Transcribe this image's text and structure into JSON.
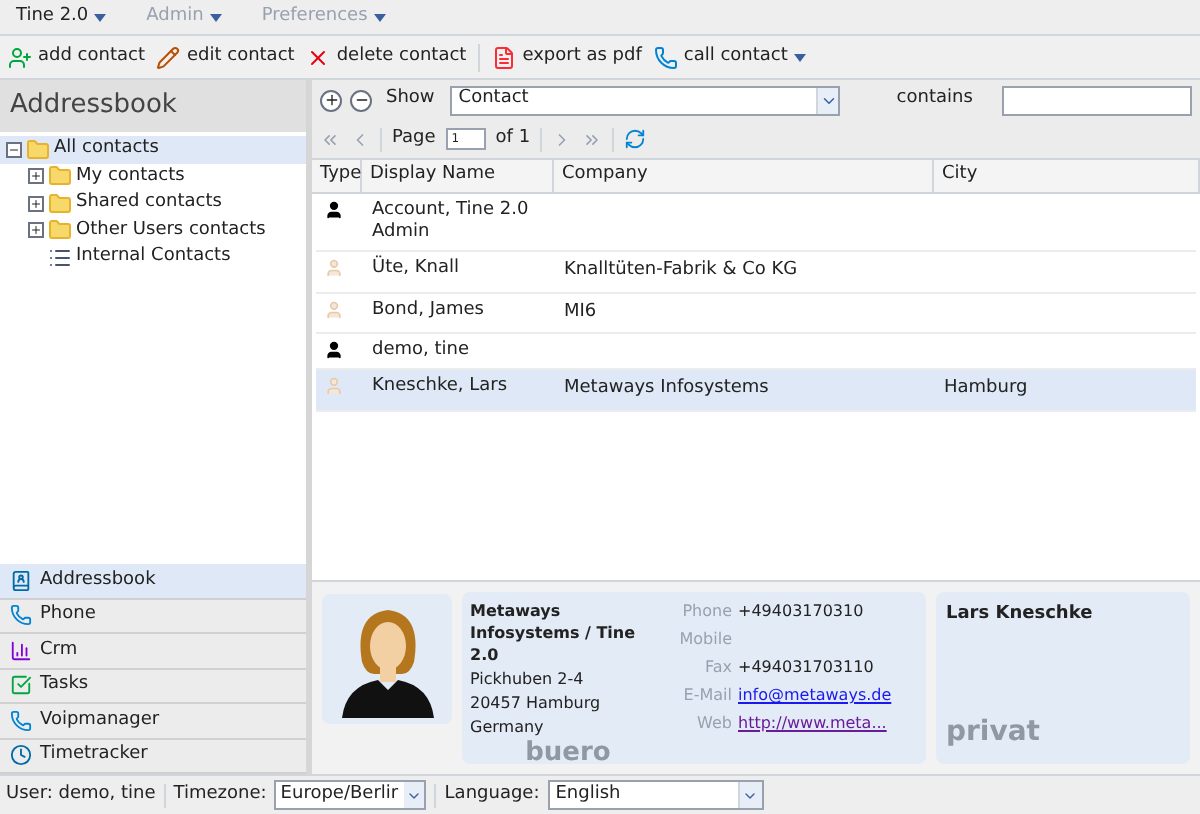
{
  "menu": [
    {
      "label": "Tine 2.0",
      "disabled": false
    },
    {
      "label": "Admin",
      "disabled": true
    },
    {
      "label": "Preferences",
      "disabled": true
    }
  ],
  "toolbar": [
    {
      "label": "add contact",
      "kind": "add"
    },
    {
      "label": "edit contact",
      "kind": "edit"
    },
    {
      "label": "delete contact",
      "kind": "delete"
    },
    {
      "label": "export as pdf",
      "kind": "pdf"
    },
    {
      "label": "call contact",
      "kind": "phone",
      "dropdown": true
    }
  ],
  "filter": {
    "label": "Show",
    "field": "Contact",
    "operator": "contains"
  },
  "paging": {
    "page_label": "Page",
    "page": "1",
    "of": "of 1"
  },
  "sidebar": {
    "title": "Addressbook",
    "tree": [
      {
        "label": "All contacts",
        "kind": "folder",
        "expanded": true,
        "selected": true,
        "children": [
          {
            "label": "My contacts",
            "kind": "folder",
            "expanded": false,
            "selected": false
          },
          {
            "label": "Shared contacts",
            "kind": "folder",
            "expanded": false,
            "selected": false
          },
          {
            "label": "Other Users contacts",
            "kind": "folder",
            "expanded": false,
            "selected": false
          },
          {
            "label": "Internal Contacts",
            "kind": "list",
            "selected": false
          }
        ]
      }
    ]
  },
  "apps": [
    {
      "label": "Addressbook",
      "kind": "addressbook",
      "selected": true
    },
    {
      "label": "Phone",
      "kind": "phone",
      "selected": false
    },
    {
      "label": "Crm",
      "kind": "crm",
      "selected": false
    },
    {
      "label": "Tasks",
      "kind": "tasks",
      "selected": false
    },
    {
      "label": "Voipmanager",
      "kind": "phone",
      "selected": false
    },
    {
      "label": "Timetracker",
      "kind": "timetracker",
      "selected": false
    }
  ],
  "table": {
    "columns": [
      "Type",
      "Display Name",
      "Company",
      "City"
    ],
    "rows": [
      {
        "kind": "account",
        "display_name": "Account, Tine 2.0 Admin",
        "selected": false
      },
      {
        "kind": "contact",
        "display_name": "Üte, Knall",
        "company": "Knalltüten-Fabrik & Co KG",
        "selected": false
      },
      {
        "kind": "contact",
        "display_name": "Bond, James",
        "company": "MI6",
        "selected": false
      },
      {
        "kind": "account",
        "display_name": "demo, tine",
        "selected": false
      },
      {
        "kind": "contact",
        "display_name": "Kneschke, Lars",
        "company": "Metaways Infosystems",
        "city": "Hamburg",
        "selected": true
      }
    ]
  },
  "details": {
    "company": "Metaways Infosystems / Tine 2.0",
    "address": [
      "Pickhuben 2-4",
      "20457 Hamburg",
      "Germany"
    ],
    "tag": "buero",
    "fields": [
      {
        "label": "Phone",
        "value": "+49403170310"
      },
      {
        "label": "Mobile"
      },
      {
        "label": "Fax",
        "value": "+494031703110"
      },
      {
        "label": "E-Mail",
        "value": "info@metaways.de",
        "kind": "link"
      },
      {
        "label": "Web",
        "value": "http://www.meta...",
        "kind": "visited-link"
      }
    ],
    "private": {
      "name": "Lars Kneschke",
      "tag": "privat"
    }
  },
  "status": {
    "user": "User: demo, tine",
    "timezone_label": "Timezone:",
    "timezone": "Europe/Berlir",
    "language_label": "Language:",
    "language": "English"
  }
}
